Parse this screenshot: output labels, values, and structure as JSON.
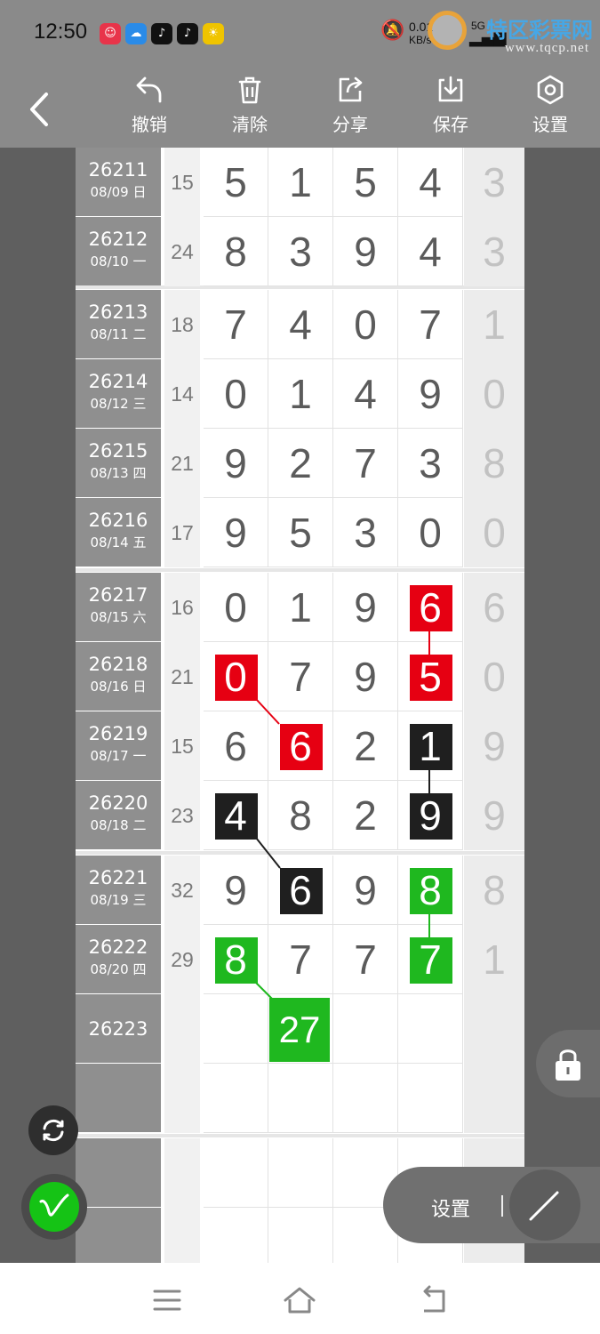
{
  "status_bar": {
    "time": "12:50",
    "net_speed_value": "0.01",
    "net_speed_unit": "KB/s",
    "signal_label": "5G"
  },
  "watermark": {
    "site_name": "特区彩票网",
    "url": "www.tqcp.net"
  },
  "toolbar": {
    "buttons": [
      {
        "label": "撤销",
        "icon": "undo-icon"
      },
      {
        "label": "清除",
        "icon": "trash-icon"
      },
      {
        "label": "分享",
        "icon": "share-icon"
      },
      {
        "label": "保存",
        "icon": "download-icon"
      },
      {
        "label": "设置",
        "icon": "settings-hexagon-icon"
      }
    ]
  },
  "rows": [
    {
      "issue": "26211",
      "date": "08/09 日",
      "sum": "15",
      "digits": [
        "5",
        "1",
        "5",
        "4"
      ],
      "last": "3"
    },
    {
      "issue": "26212",
      "date": "08/10 一",
      "sum": "24",
      "digits": [
        "8",
        "3",
        "9",
        "4"
      ],
      "last": "3"
    },
    {
      "issue": "26213",
      "date": "08/11 二",
      "sum": "18",
      "digits": [
        "7",
        "4",
        "0",
        "7"
      ],
      "last": "1"
    },
    {
      "issue": "26214",
      "date": "08/12 三",
      "sum": "14",
      "digits": [
        "0",
        "1",
        "4",
        "9"
      ],
      "last": "0"
    },
    {
      "issue": "26215",
      "date": "08/13 四",
      "sum": "21",
      "digits": [
        "9",
        "2",
        "7",
        "3"
      ],
      "last": "8"
    },
    {
      "issue": "26216",
      "date": "08/14 五",
      "sum": "17",
      "digits": [
        "9",
        "5",
        "3",
        "0"
      ],
      "last": "0"
    },
    {
      "issue": "26217",
      "date": "08/15 六",
      "sum": "16",
      "digits": [
        "0",
        "1",
        "9",
        "6"
      ],
      "last": "6"
    },
    {
      "issue": "26218",
      "date": "08/16 日",
      "sum": "21",
      "digits": [
        "0",
        "7",
        "9",
        "5"
      ],
      "last": "0"
    },
    {
      "issue": "26219",
      "date": "08/17 一",
      "sum": "15",
      "digits": [
        "6",
        "6",
        "2",
        "1"
      ],
      "last": "9"
    },
    {
      "issue": "26220",
      "date": "08/18 二",
      "sum": "23",
      "digits": [
        "4",
        "8",
        "2",
        "9"
      ],
      "last": "9"
    },
    {
      "issue": "26221",
      "date": "08/19 三",
      "sum": "32",
      "digits": [
        "9",
        "6",
        "9",
        "8"
      ],
      "last": "8"
    },
    {
      "issue": "26222",
      "date": "08/20 四",
      "sum": "29",
      "digits": [
        "8",
        "7",
        "7",
        "7"
      ],
      "last": "1"
    },
    {
      "issue": "26223",
      "date": "",
      "sum": "",
      "digits": [
        "",
        "",
        "",
        ""
      ],
      "last": ""
    }
  ],
  "prediction": {
    "value": "27"
  },
  "marks": {
    "red": "#e60012",
    "black": "#1f1f1f",
    "green": "#1fb81f"
  },
  "floating": {
    "settings_label": "设置",
    "lock_icon": "lock-icon",
    "refresh_icon": "refresh-icon",
    "pen_icon": "pen-icon",
    "line_tool_icon": "line-tool-icon"
  },
  "nav_bar": {
    "icons": [
      "menu-icon",
      "home-icon",
      "back-icon"
    ]
  }
}
